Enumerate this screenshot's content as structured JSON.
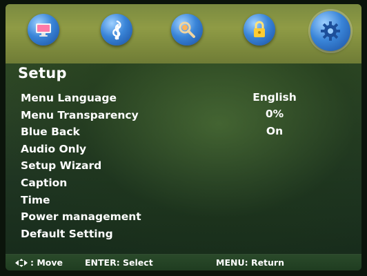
{
  "icons": [
    {
      "name": "tv-picture-icon",
      "selected": false
    },
    {
      "name": "music-note-icon",
      "selected": false
    },
    {
      "name": "search-channel-icon",
      "selected": false
    },
    {
      "name": "lock-icon",
      "selected": false
    },
    {
      "name": "gear-icon",
      "selected": true
    }
  ],
  "page_title": "Setup",
  "menu": {
    "items": [
      {
        "label": "Menu Language",
        "value": "English"
      },
      {
        "label": "Menu Transparency",
        "value": "0%"
      },
      {
        "label": "Blue Back",
        "value": "On"
      },
      {
        "label": "Audio Only"
      },
      {
        "label": "Setup Wizard"
      },
      {
        "label": "Caption"
      },
      {
        "label": "Time"
      },
      {
        "label": "Power management"
      },
      {
        "label": "Default Setting"
      }
    ]
  },
  "footer": {
    "move": ": Move",
    "enter": "ENTER: Select",
    "menu": "MENU: Return"
  }
}
